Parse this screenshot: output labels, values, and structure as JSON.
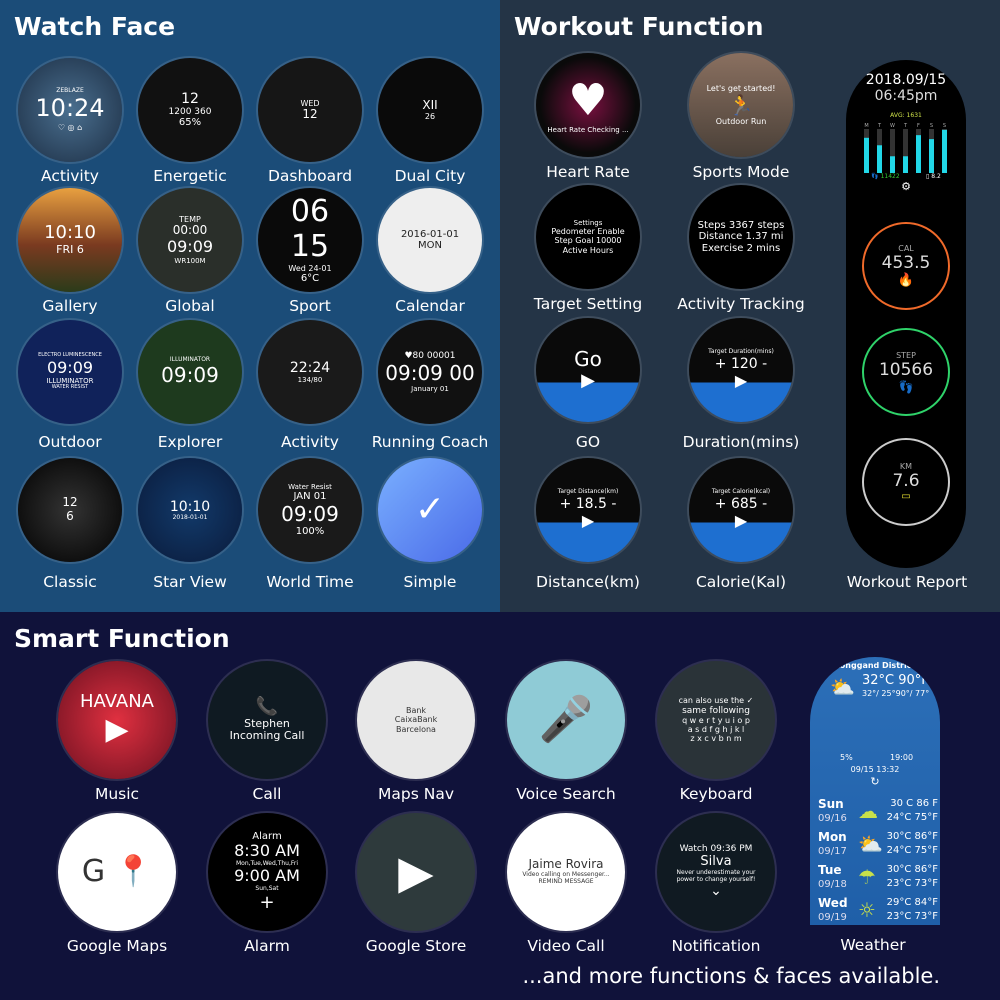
{
  "watch_face": {
    "title": "Watch Face",
    "items": [
      {
        "label": "Activity",
        "screen": [
          "ZEBLAZE",
          "10:24",
          "♡ ◎ ⌂"
        ]
      },
      {
        "label": "Energetic",
        "screen": [
          "12",
          "1200  360",
          "65%"
        ]
      },
      {
        "label": "Dashboard",
        "screen": [
          "WED",
          "12"
        ]
      },
      {
        "label": "Dual City",
        "screen": [
          "XII",
          "26"
        ]
      },
      {
        "label": "Gallery",
        "screen": [
          "10:10",
          "FRI 6"
        ]
      },
      {
        "label": "Global",
        "screen": [
          "TEMP",
          "00:00",
          "09:09",
          "WR100M"
        ]
      },
      {
        "label": "Sport",
        "screen": [
          "06",
          "15",
          "Wed 24-01",
          "6°C"
        ]
      },
      {
        "label": "Calendar",
        "screen": [
          "2016-01-01",
          "MON"
        ]
      },
      {
        "label": "Outdoor",
        "screen": [
          "ELECTRO LUMINESCENCE",
          "09:09",
          "ILLUMINATOR",
          "WATER RESIST"
        ]
      },
      {
        "label": "Explorer",
        "screen": [
          "ILLUMINATOR",
          "09:09"
        ]
      },
      {
        "label": "Activity",
        "screen": [
          "22:24",
          "134/80"
        ]
      },
      {
        "label": "Running Coach",
        "screen": [
          "♥80  00001",
          "09:09 00",
          "January 01"
        ]
      },
      {
        "label": "Classic",
        "screen": [
          "12",
          "6"
        ]
      },
      {
        "label": "Star View",
        "screen": [
          "10:10",
          "2018-01-01"
        ]
      },
      {
        "label": "World Time",
        "screen": [
          "Water Resist",
          "JAN 01",
          "09:09",
          "100%"
        ]
      },
      {
        "label": "Simple",
        "screen": [
          "✓"
        ]
      }
    ]
  },
  "workout": {
    "title": "Workout Function",
    "items": [
      {
        "label": "Heart Rate",
        "screen": [
          "♥",
          "Heart Rate Checking ..."
        ]
      },
      {
        "label": "Sports Mode",
        "screen": [
          "Let's get started!",
          "🏃",
          "Outdoor Run"
        ]
      },
      {
        "label": "Target Setting",
        "screen": [
          "Settings",
          "Pedometer  Enable",
          "Step Goal  10000",
          "Active Hours"
        ]
      },
      {
        "label": "Activity Tracking",
        "screen": [
          "Steps 3367 steps",
          "Distance 1.37 mi",
          "Exercise 2 mins"
        ]
      },
      {
        "label": "GO",
        "screen": [
          "Go",
          "▶"
        ]
      },
      {
        "label": "Duration(mins)",
        "screen": [
          "Target Duration(mins)",
          "+ 120 -",
          "▶"
        ]
      },
      {
        "label": "Distance(km)",
        "screen": [
          "Target Distance(km)",
          "+ 18.5 -",
          "▶"
        ]
      },
      {
        "label": "Calorie(Kal)",
        "screen": [
          "Target Calorie(kcal)",
          "+ 685 -",
          "▶"
        ]
      }
    ],
    "report": {
      "label": "Workout Report",
      "date": "2018.09/15",
      "time": "06:45pm",
      "avg": "AVG: 1631",
      "days": [
        "M",
        "T",
        "W",
        "T",
        "F",
        "S",
        "S"
      ],
      "bar_levels": [
        0.8,
        0.63,
        0.38,
        0.38,
        0.86,
        0.77,
        0.98
      ],
      "steps": "11422",
      "km_small": "8.2",
      "cal_key": "CAL",
      "cal": "453.5",
      "step_key": "STEP",
      "step": "10566",
      "km_key": "KM",
      "km": "7.6",
      "colors": {
        "bars": "#22d8e8",
        "cal": "#f06a2a",
        "step": "#2fd36a",
        "km": "#cccccc"
      }
    }
  },
  "smart": {
    "title": "Smart Function",
    "items": [
      {
        "label": "Music",
        "screen": [
          "HAVANA",
          "▶"
        ]
      },
      {
        "label": "Call",
        "screen": [
          "📞",
          "Stephen",
          "Incoming Call"
        ]
      },
      {
        "label": "Maps Nav",
        "screen": [
          "Bank",
          "CaixaBank",
          "Barcelona"
        ]
      },
      {
        "label": "Voice Search",
        "screen": [
          "🎤"
        ]
      },
      {
        "label": "Keyboard",
        "screen": [
          "can also use the ✓",
          "same  following",
          "q w e r t y u i o p",
          "a s d f g h j k l",
          "z x c v b n m"
        ]
      },
      {
        "label": "Google Maps",
        "screen": [
          "G 📍"
        ]
      },
      {
        "label": "Alarm",
        "screen": [
          "Alarm",
          "8:30 AM",
          "Mon,Tue,Wed,Thu,Fri",
          "9:00 AM",
          "Sun,Sat",
          "+"
        ]
      },
      {
        "label": "Google Store",
        "screen": [
          "▶"
        ]
      },
      {
        "label": "Video Call",
        "screen": [
          "Jaime Rovira",
          "Video calling on Messenger...",
          "REMIND  MESSAGE"
        ]
      },
      {
        "label": "Notification",
        "screen": [
          "Watch 09:36 PM",
          "Silva",
          "Never underestimate your",
          "power to change yourself!",
          "⌄"
        ]
      }
    ],
    "weather": {
      "label": "Weather",
      "district": "Longgand District",
      "now": "32°C 90°F",
      "range": "32°/ 25°90°/ 77°",
      "rain": "5%",
      "time": "19:00",
      "updated": "09/15 13:32",
      "days": [
        {
          "day": "Sun",
          "date": "09/16",
          "icon": "storm",
          "hi": "30 C 86 F",
          "lo": "24°C 75°F"
        },
        {
          "day": "Mon",
          "date": "09/17",
          "icon": "rain-sun",
          "hi": "30°C 86°F",
          "lo": "24°C 75°F"
        },
        {
          "day": "Tue",
          "date": "09/18",
          "icon": "rain",
          "hi": "30°C 86°F",
          "lo": "23°C 73°F"
        },
        {
          "day": "Wed",
          "date": "09/19",
          "icon": "sun",
          "hi": "29°C 84°F",
          "lo": "23°C 73°F"
        }
      ]
    },
    "footer": "...and more functions & faces available."
  }
}
